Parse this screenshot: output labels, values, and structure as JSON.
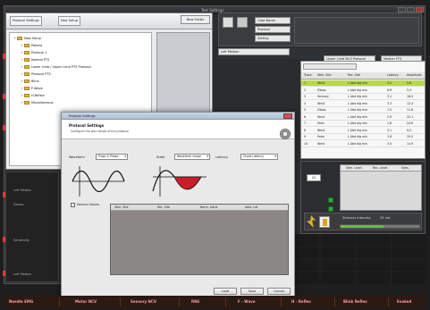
{
  "window": {
    "title": "Test Settings"
  },
  "folder_panel": {
    "toolbar_buttons": [
      "Protocol Settings",
      "New Setup"
    ],
    "new_folder": "New Folder",
    "tree": [
      {
        "label": "New Setup",
        "indent": 0
      },
      {
        "label": "Patient",
        "indent": 1
      },
      {
        "label": "Protocol 1",
        "indent": 1
      },
      {
        "label": "Normal PTS",
        "indent": 1
      },
      {
        "label": "Lower Limb / Upper Limb PTS Protocol",
        "indent": 1
      },
      {
        "label": "Protocol PTS",
        "indent": 1
      },
      {
        "label": "Blink",
        "indent": 1
      },
      {
        "label": "F-Wave",
        "indent": 1
      },
      {
        "label": "H-Reflex",
        "indent": 1
      },
      {
        "label": "Miscellaneous",
        "indent": 1
      }
    ]
  },
  "upper_toolbar": {
    "fields": [
      "Case Name",
      "Protocol",
      "Setting"
    ]
  },
  "protocol_row": {
    "left_value": "Left Median",
    "combo": "Upper Limb NCS Protocol",
    "right_combo": "Median FTS"
  },
  "table": {
    "headers": [
      "Trace",
      "Stim. Site",
      "Rec. Site",
      "Latency",
      "Amplitude"
    ],
    "rows": [
      [
        "1",
        "Wrist",
        "L Abd dig min",
        "3.2",
        "5.8"
      ],
      [
        "2",
        "Elbow",
        "L Abd dig min",
        "6.8",
        "5.4"
      ],
      [
        "3",
        "Sensory",
        "L Abd dig min",
        "3.1",
        "18.2"
      ],
      [
        "4",
        "Wrist",
        "L Abd dig min",
        "3.3",
        "12.4"
      ],
      [
        "5",
        "Elbow",
        "L Abd dig min",
        "7.0",
        "11.8"
      ],
      [
        "6",
        "Wrist",
        "L Abd dig min",
        "2.9",
        "22.1"
      ],
      [
        "7",
        "Palm",
        "L Abd dig min",
        "1.6",
        "24.6"
      ],
      [
        "8",
        "Wrist",
        "L Abd dig min",
        "3.1",
        "9.2"
      ],
      [
        "9",
        "Palm",
        "L Abd dig min",
        "1.8",
        "20.5"
      ],
      [
        "10",
        "Wrist",
        "L Abd dig min",
        "3.0",
        "14.9"
      ]
    ]
  },
  "right_lower": {
    "box_value": "20",
    "mid_headers": [
      "Stim. Level",
      "Rec. Level",
      "Sens."
    ],
    "stimulus_label": "Stimulus Intensity",
    "stimulus_value": "25 mA",
    "progress_percent": 55
  },
  "left_lower": {
    "labels": [
      "Left Median",
      "Sweep",
      "Sensitivity",
      "Left Median"
    ]
  },
  "dialog": {
    "title": "Protocol Settings",
    "heading": "Protocol Settings",
    "subheading": "Configure the test values of the protocol",
    "waveform_label": "Waveform",
    "waveform_value": "Pulse & Phase",
    "state_label": "State",
    "state_value": "Waveform shape",
    "latency_label": "Latency",
    "latency_value": "Onset Latency",
    "normal_values_label": "Normal Values",
    "table_headers": [
      "Stim. Site",
      "Rec. Site",
      "Norm. value",
      "Amb. Lat"
    ],
    "buttons": [
      "Load",
      "Save",
      "Cancel"
    ]
  },
  "bottom_bar": [
    "Needle EMG",
    "Motor NCV",
    "Sensory NCV",
    "RNS",
    "F - Wave",
    "H - Reflex",
    "Blink Reflex",
    "Evoked"
  ],
  "colors": {
    "accent_green": "#b8d84a",
    "bottom_text": "#ff9b9b",
    "waveform_red": "#c81e2a"
  }
}
